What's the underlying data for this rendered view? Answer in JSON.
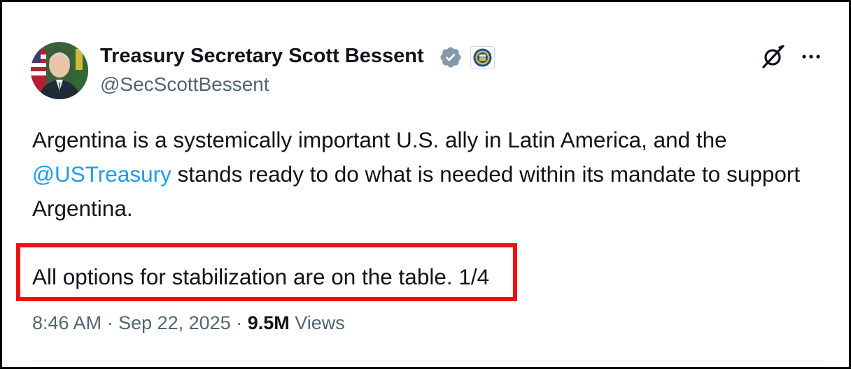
{
  "author": {
    "display_name": "Treasury Secretary Scott Bessent",
    "handle": "@SecScottBessent",
    "verified_badge": "gray-verified-checkmark-icon",
    "affiliation_badge": "treasury-seal-icon"
  },
  "actions": {
    "grok_icon": "grok-icon",
    "more_icon": "more-options-icon"
  },
  "tweet": {
    "line1_before": "Argentina is a systemically important U.S. ally in Latin America, and the ",
    "mention": "@USTreasury",
    "line1_after": " stands ready to do what is needed within its mandate to support Argentina.",
    "para2": "All options for stabilization are on the table. 1/4"
  },
  "meta": {
    "time": "8:46 AM",
    "separator": " · ",
    "date": "Sep 22, 2025",
    "separator2": " · ",
    "views_count": "9.5M",
    "views_label": " Views"
  },
  "annotation": {
    "highlight_color": "#ee1111"
  },
  "colors": {
    "text": "#0f1419",
    "secondary": "#536471",
    "link": "#1d9bf0"
  }
}
